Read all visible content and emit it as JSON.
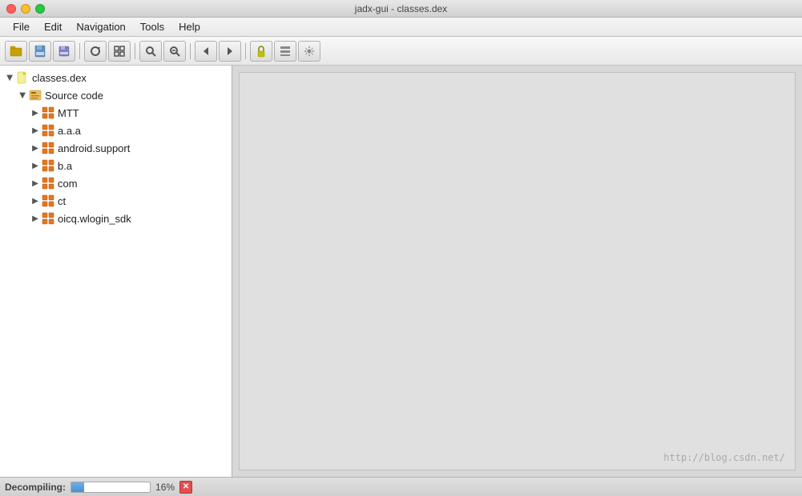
{
  "window": {
    "title": "jadx-gui - classes.dex",
    "title_btn_close": "",
    "title_btn_minimize": "",
    "title_btn_maximize": ""
  },
  "menubar": {
    "items": [
      {
        "id": "file",
        "label": "File"
      },
      {
        "id": "edit",
        "label": "Edit"
      },
      {
        "id": "navigation",
        "label": "Navigation"
      },
      {
        "id": "tools",
        "label": "Tools"
      },
      {
        "id": "help",
        "label": "Help"
      }
    ]
  },
  "toolbar": {
    "buttons": [
      {
        "id": "open",
        "icon": "📂",
        "tooltip": "Open"
      },
      {
        "id": "save-all",
        "icon": "💾",
        "tooltip": "Save All"
      },
      {
        "id": "save",
        "icon": "🗂",
        "tooltip": "Save"
      },
      {
        "id": "refresh",
        "icon": "🔄",
        "tooltip": "Refresh"
      },
      {
        "id": "sync",
        "icon": "⊞",
        "tooltip": "Sync"
      },
      {
        "id": "search",
        "icon": "🔍",
        "tooltip": "Search"
      },
      {
        "id": "find",
        "icon": "🔎",
        "tooltip": "Find"
      },
      {
        "id": "back",
        "icon": "←",
        "tooltip": "Back"
      },
      {
        "id": "forward",
        "icon": "→",
        "tooltip": "Forward"
      },
      {
        "id": "lock",
        "icon": "🔒",
        "tooltip": "Lock"
      },
      {
        "id": "layout",
        "icon": "▤",
        "tooltip": "Layout"
      },
      {
        "id": "settings",
        "icon": "⚙",
        "tooltip": "Settings"
      }
    ]
  },
  "tree": {
    "root": {
      "label": "classes.dex",
      "expanded": true,
      "children": [
        {
          "label": "Source code",
          "icon": "source",
          "expanded": true,
          "children": [
            {
              "label": "MTT",
              "icon": "package"
            },
            {
              "label": "a.a.a",
              "icon": "package"
            },
            {
              "label": "android.support",
              "icon": "package"
            },
            {
              "label": "b.a",
              "icon": "package"
            },
            {
              "label": "com",
              "icon": "package"
            },
            {
              "label": "ct",
              "icon": "package"
            },
            {
              "label": "oicq.wlogin_sdk",
              "icon": "package"
            }
          ]
        }
      ]
    }
  },
  "right_panel": {
    "watermark": "http://blog.csdn.net/"
  },
  "statusbar": {
    "decompiling_label": "Decompiling:",
    "progress_percent": "16%",
    "progress_value": 16
  }
}
